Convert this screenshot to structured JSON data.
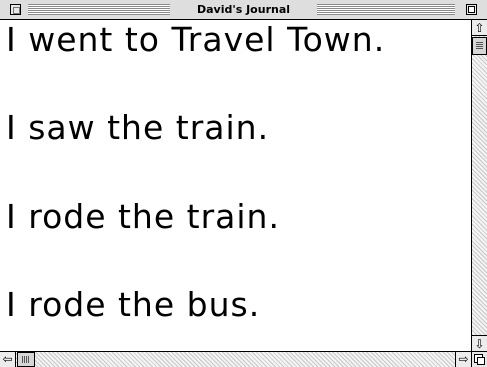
{
  "window": {
    "title": "David's Journal"
  },
  "document": {
    "lines": [
      "I went to Travel Town.",
      "I saw the train.",
      "I rode the train.",
      "I rode the bus."
    ]
  },
  "icons": {
    "close": "close-box",
    "zoom": "zoom-box",
    "scroll_up": "up-arrow",
    "scroll_down": "down-arrow",
    "scroll_left": "left-arrow",
    "scroll_right": "right-arrow",
    "grow": "grow-box"
  }
}
